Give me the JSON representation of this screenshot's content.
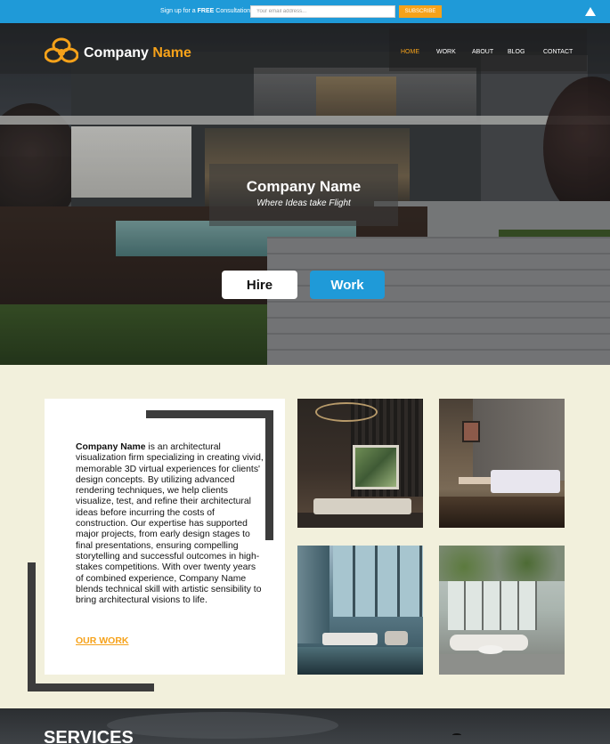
{
  "topbar": {
    "signup_prefix": "Sign up for a ",
    "signup_bold": "FREE",
    "signup_suffix": " Consultation",
    "email_placeholder": "Your email address...",
    "subscribe_label": "SUBSCRIBE",
    "scroll_top_icon": "triangle-up-icon"
  },
  "nav": {
    "brand_part1": "Company ",
    "brand_part2": "Name",
    "logo_icon": "flower-logo-icon",
    "items": [
      {
        "label": "HOME",
        "active": true
      },
      {
        "label": "WORK",
        "active": false
      },
      {
        "label": "ABOUT",
        "active": false
      },
      {
        "label": "BLOG",
        "active": false
      },
      {
        "label": "CONTACT",
        "active": false
      }
    ]
  },
  "hero": {
    "title": "Company Name",
    "tagline": "Where Ideas take Flight",
    "hire_label": "Hire",
    "work_label": "Work"
  },
  "about": {
    "company": "Company Name",
    "body": " is an architectural visualization firm specializing in creating vivid, memorable 3D virtual experiences for clients' design concepts. By utilizing advanced rendering techniques, we help clients visualize, test, and refine their architectural ideas before incurring the costs of construction. Our expertise has supported major projects, from early design stages to final presentations, ensuring compelling storytelling and successful outcomes in high-stakes competitions. With over twenty years of combined experience, Company Name blends technical skill with artistic sensibility to bring architectural visions to life.",
    "link_label": "OUR WORK"
  },
  "services": {
    "title": "SERVICES"
  },
  "colors": {
    "accent": "#f6a21a",
    "primary_blue": "#1f9ad8",
    "section_bg": "#f2f0dc",
    "frame_dark": "#3c3c3c"
  }
}
